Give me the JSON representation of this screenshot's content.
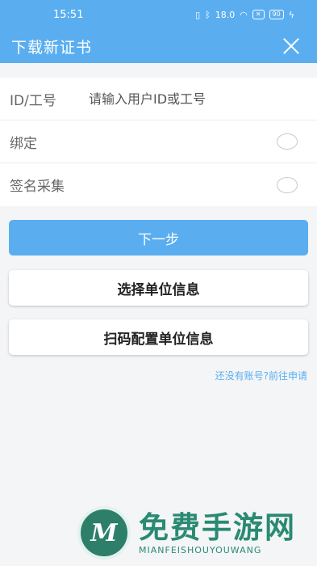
{
  "status_bar": {
    "time": "15:51",
    "icons": [
      "vibrate-icon",
      "bluetooth-icon",
      "net-speed",
      "wifi-icon",
      "sim-icon",
      "battery-icon"
    ],
    "speed": "18.0",
    "battery": "90"
  },
  "app_bar": {
    "title": "下载新证书",
    "close_icon": "close-icon"
  },
  "form": {
    "id_label": "ID/工号",
    "id_placeholder": "请输入用户ID或工号",
    "bind_label": "绑定",
    "sign_label": "签名采集"
  },
  "buttons": {
    "next": "下一步",
    "select_unit": "选择单位信息",
    "scan_unit": "扫码配置单位信息"
  },
  "register_link": "还没有账号?前往申请",
  "watermark": {
    "logo_letter": "M",
    "cn": "免费手游网",
    "en": "MIANFEISHOUYOUWANG"
  },
  "colors": {
    "primary": "#5aaef0",
    "background": "#f4f5f7"
  }
}
